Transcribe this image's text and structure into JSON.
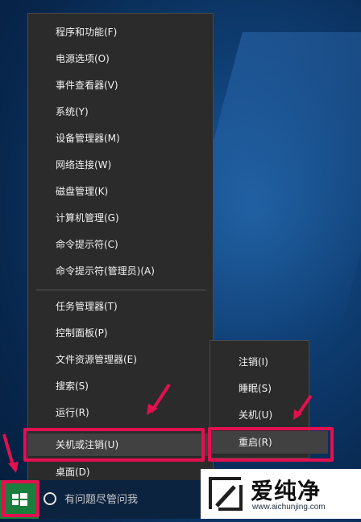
{
  "context_menu": {
    "items": [
      "程序和功能(F)",
      "电源选项(O)",
      "事件查看器(V)",
      "系统(Y)",
      "设备管理器(M)",
      "网络连接(W)",
      "磁盘管理(K)",
      "计算机管理(G)",
      "命令提示符(C)",
      "命令提示符(管理员)(A)"
    ],
    "items2": [
      "任务管理器(T)",
      "控制面板(P)",
      "文件资源管理器(E)",
      "搜索(S)",
      "运行(R)",
      "关机或注销(U)",
      "桌面(D)"
    ],
    "highlighted": "关机或注销(U)"
  },
  "shutdown_submenu": {
    "items": [
      "注销(I)",
      "睡眠(S)",
      "关机(U)",
      "重启(R)"
    ],
    "highlighted": "重启(R)"
  },
  "taskbar": {
    "search_placeholder": "有问题尽管问我"
  },
  "watermark": {
    "brand": "爱纯净",
    "url": "www.aichunjing.com"
  },
  "colors": {
    "annotation": "#e3104f",
    "menu_bg": "#2b2b2b",
    "start_button": "#1a7f3c"
  }
}
